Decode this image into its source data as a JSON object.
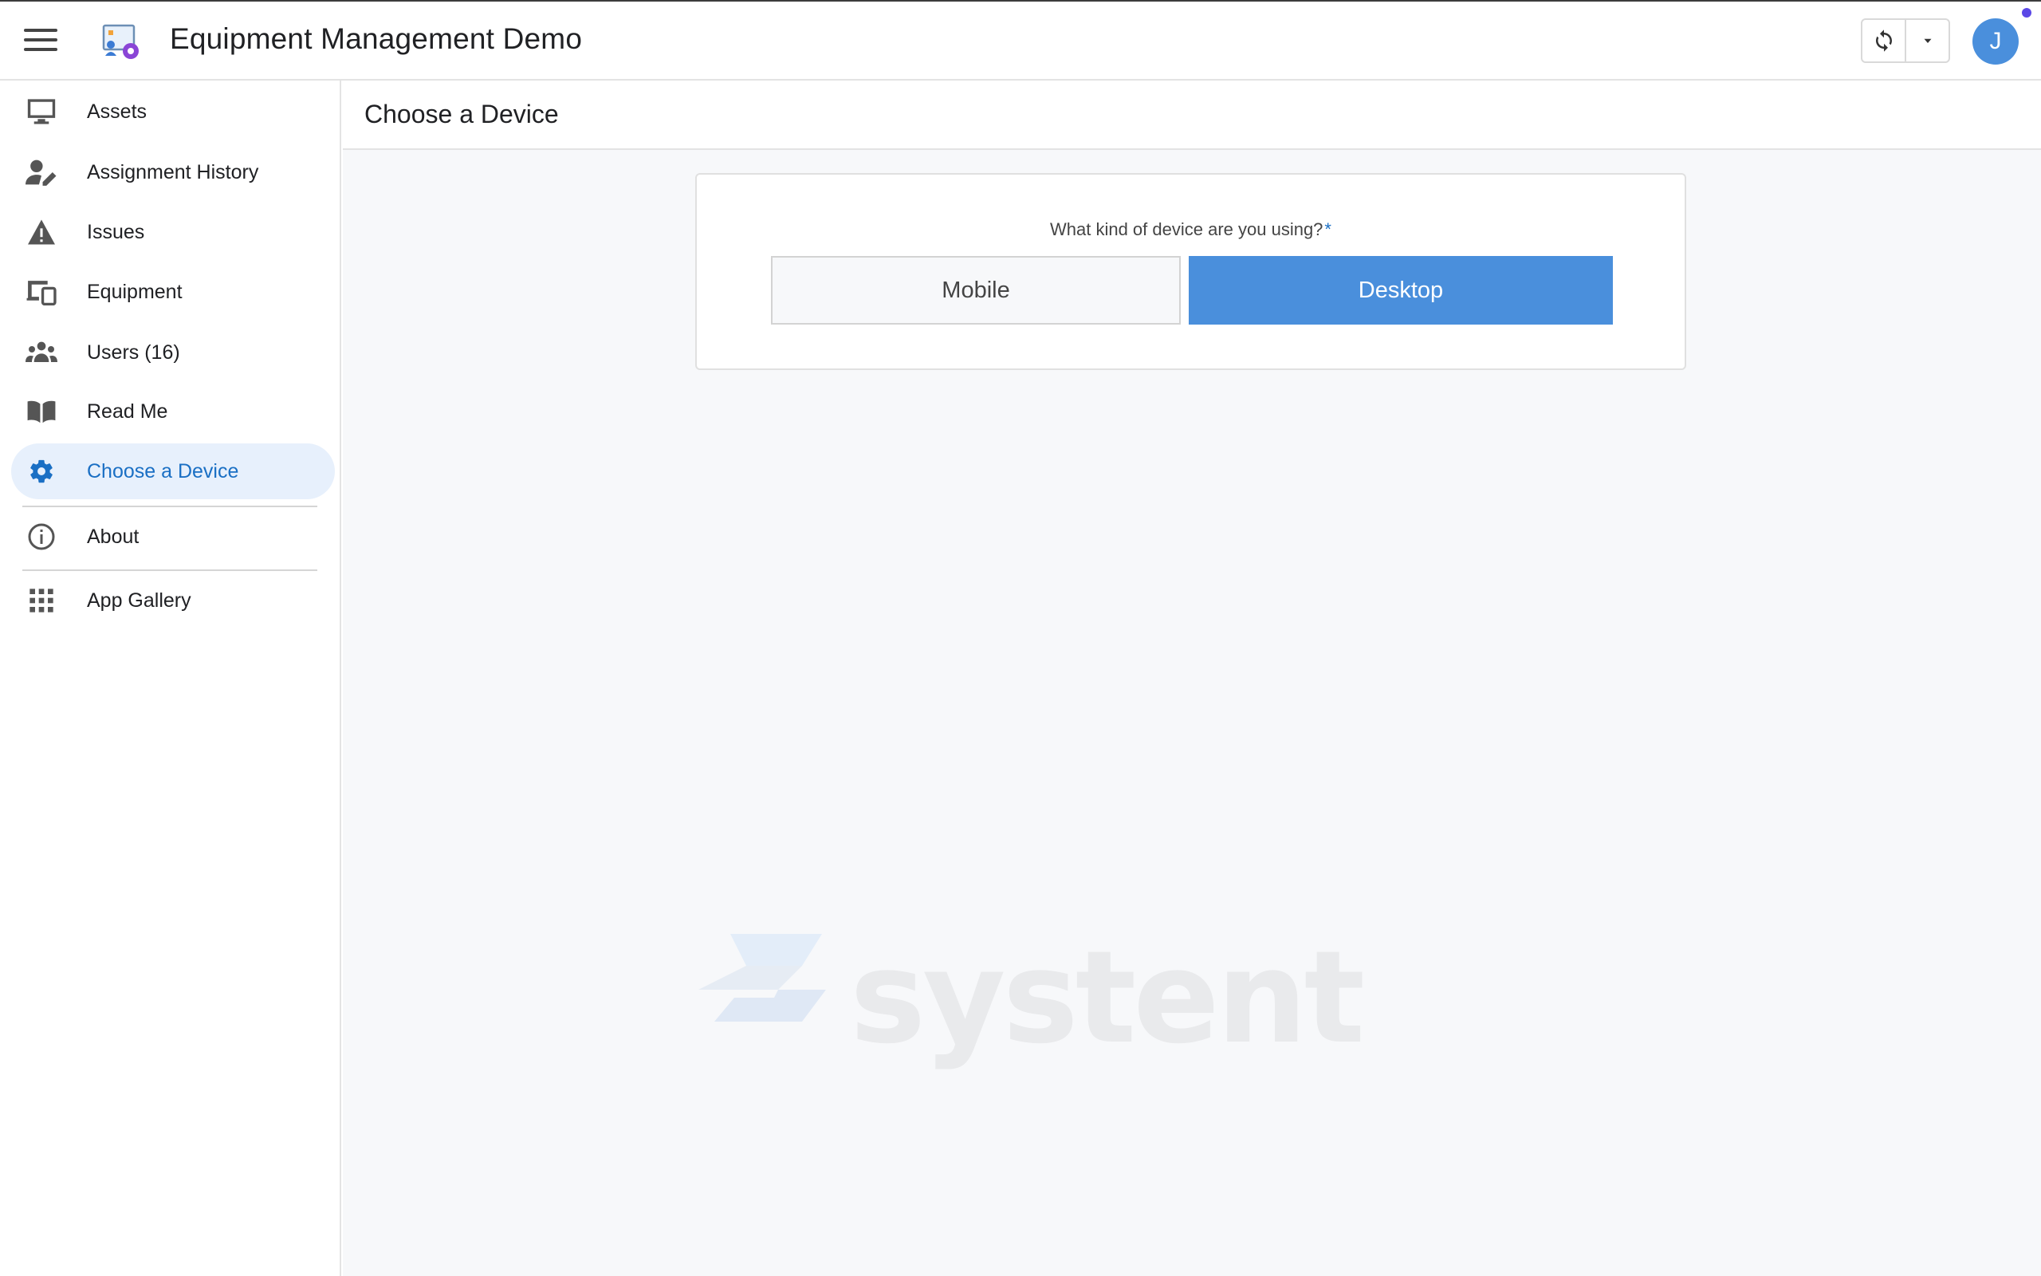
{
  "header": {
    "app_title": "Equipment Management Demo",
    "avatar_initial": "J",
    "menu_icon": "hamburger-menu-icon",
    "sync_icon": "sync-icon",
    "dropdown_icon": "caret-down-icon",
    "accent_color": "#4a8fdc",
    "notification_color": "#5b48e6"
  },
  "sidebar": {
    "items": [
      {
        "label": "Assets",
        "icon": "monitor-icon"
      },
      {
        "label": "Assignment History",
        "icon": "user-edit-icon"
      },
      {
        "label": "Issues",
        "icon": "warning-icon"
      },
      {
        "label": "Equipment",
        "icon": "devices-icon"
      },
      {
        "label": "Users (16)",
        "icon": "users-icon"
      },
      {
        "label": "Read Me",
        "icon": "book-icon"
      },
      {
        "label": "Choose a Device",
        "icon": "gear-icon",
        "active": true
      },
      {
        "label": "About",
        "icon": "info-icon"
      },
      {
        "label": "App Gallery",
        "icon": "grid-icon"
      }
    ]
  },
  "main": {
    "page_title": "Choose a Device",
    "form": {
      "question": "What kind of device are you using?",
      "required_marker": "*",
      "options": [
        "Mobile",
        "Desktop"
      ],
      "selected": "Desktop"
    },
    "watermark": "systent"
  }
}
